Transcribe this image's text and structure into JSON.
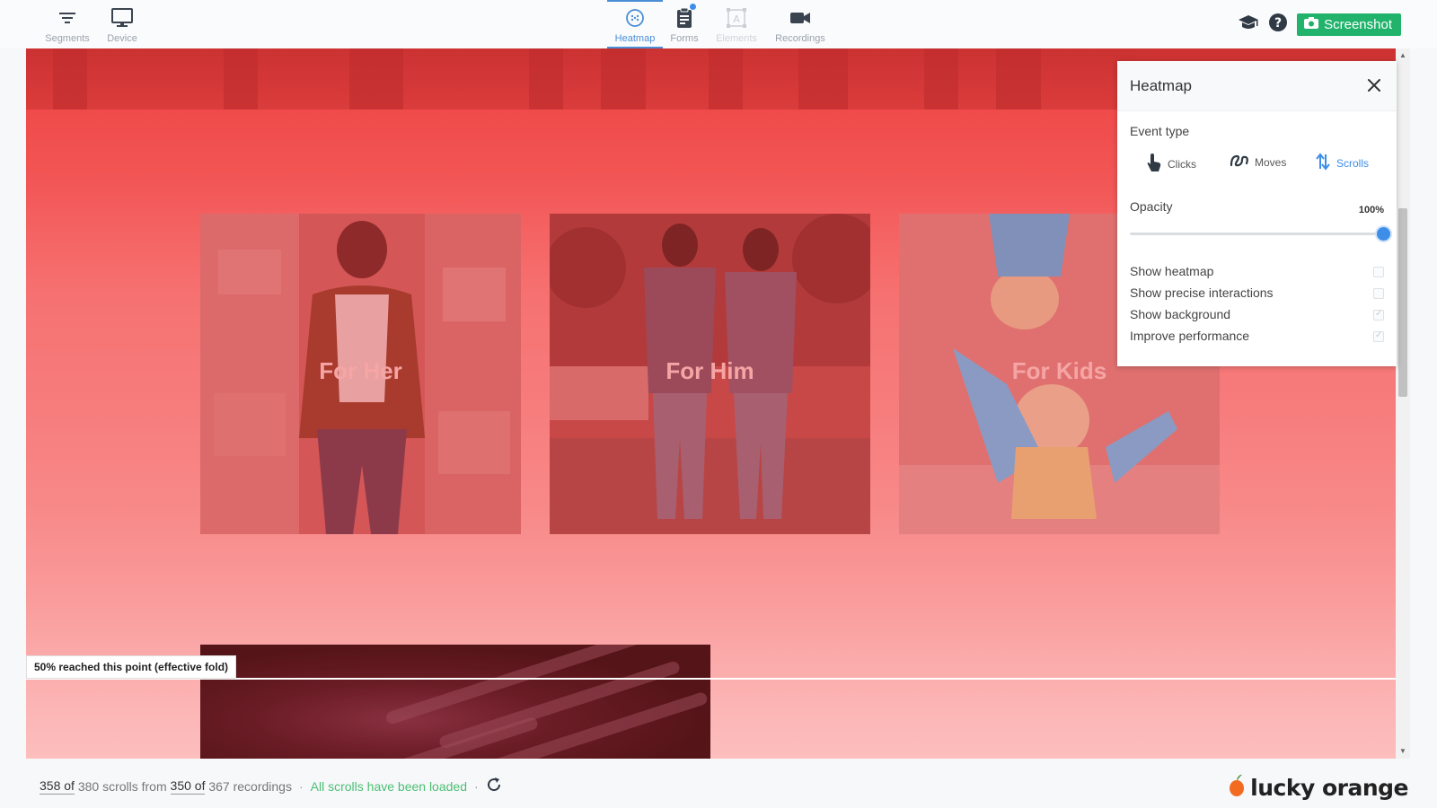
{
  "toolbar": {
    "left": [
      {
        "label": "Segments",
        "icon": "filter-icon"
      },
      {
        "label": "Device",
        "icon": "monitor-icon"
      }
    ],
    "center": [
      {
        "label": "Heatmap",
        "icon": "heatmap-icon",
        "active": true
      },
      {
        "label": "Forms",
        "icon": "clipboard-icon",
        "notification": true
      },
      {
        "label": "Elements",
        "icon": "elements-icon",
        "disabled": true
      },
      {
        "label": "Recordings",
        "icon": "video-camera-icon"
      }
    ],
    "screenshot_label": "Screenshot"
  },
  "page": {
    "cards": [
      {
        "caption": "For Her"
      },
      {
        "caption": "For Him"
      },
      {
        "caption": "For Kids"
      }
    ],
    "fold_label": "50% reached this point (effective fold)"
  },
  "panel": {
    "title": "Heatmap",
    "event_type_label": "Event type",
    "events": [
      {
        "label": "Clicks",
        "icon": "pointer-icon",
        "active": false
      },
      {
        "label": "Moves",
        "icon": "squiggle-icon",
        "active": false
      },
      {
        "label": "Scrolls",
        "icon": "scroll-arrows-icon",
        "active": true
      }
    ],
    "opacity_label": "Opacity",
    "opacity_value": "100%",
    "opacity_level": 1.0,
    "options": [
      {
        "label": "Show heatmap",
        "checked": false
      },
      {
        "label": "Show precise interactions",
        "checked": false
      },
      {
        "label": "Show background",
        "checked": true
      },
      {
        "label": "Improve performance",
        "checked": true
      }
    ]
  },
  "footer": {
    "scrolls_count": "358 of",
    "scrolls_total": "380 scrolls from",
    "recordings_count": "350 of",
    "recordings_total": "367 recordings",
    "separator": "·",
    "loaded_text": "All scrolls have been loaded",
    "brand": "lucky orange"
  },
  "colors": {
    "accent": "#3d8ee8",
    "screenshot_button": "#21b36b",
    "loaded_text": "#4bbf73",
    "heatmap_hot": "#ef4545",
    "heatmap_cool": "#fdbebe"
  }
}
